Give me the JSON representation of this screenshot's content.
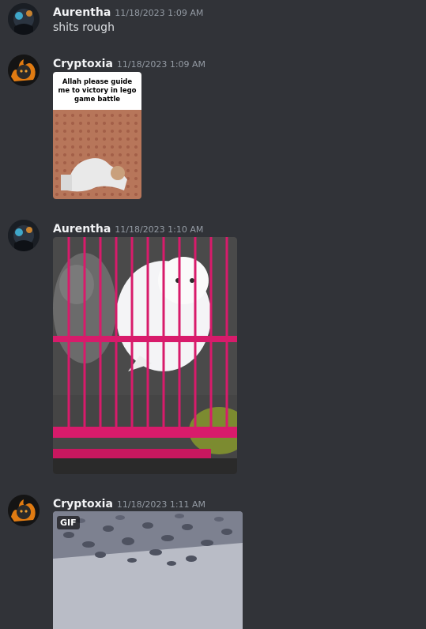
{
  "messages": [
    {
      "username": "Aurentha",
      "timestamp": "11/18/2023 1:09 AM",
      "text": "shits rough"
    },
    {
      "username": "Cryptoxia",
      "timestamp": "11/18/2023 1:09 AM",
      "attachment": {
        "kind": "meme-image",
        "caption": "Allah please guide me to victory in lego game battle"
      }
    },
    {
      "username": "Aurentha",
      "timestamp": "11/18/2023 1:10 AM",
      "attachment": {
        "kind": "image"
      }
    },
    {
      "username": "Cryptoxia",
      "timestamp": "11/18/2023 1:11 AM",
      "attachment": {
        "kind": "gif",
        "badge": "GIF"
      }
    }
  ],
  "colors": {
    "background": "#313338",
    "username": "#f2f3f5",
    "timestamp": "#949ba4",
    "message_text": "#dbdee1",
    "cage_pink": "#d81b6b"
  }
}
